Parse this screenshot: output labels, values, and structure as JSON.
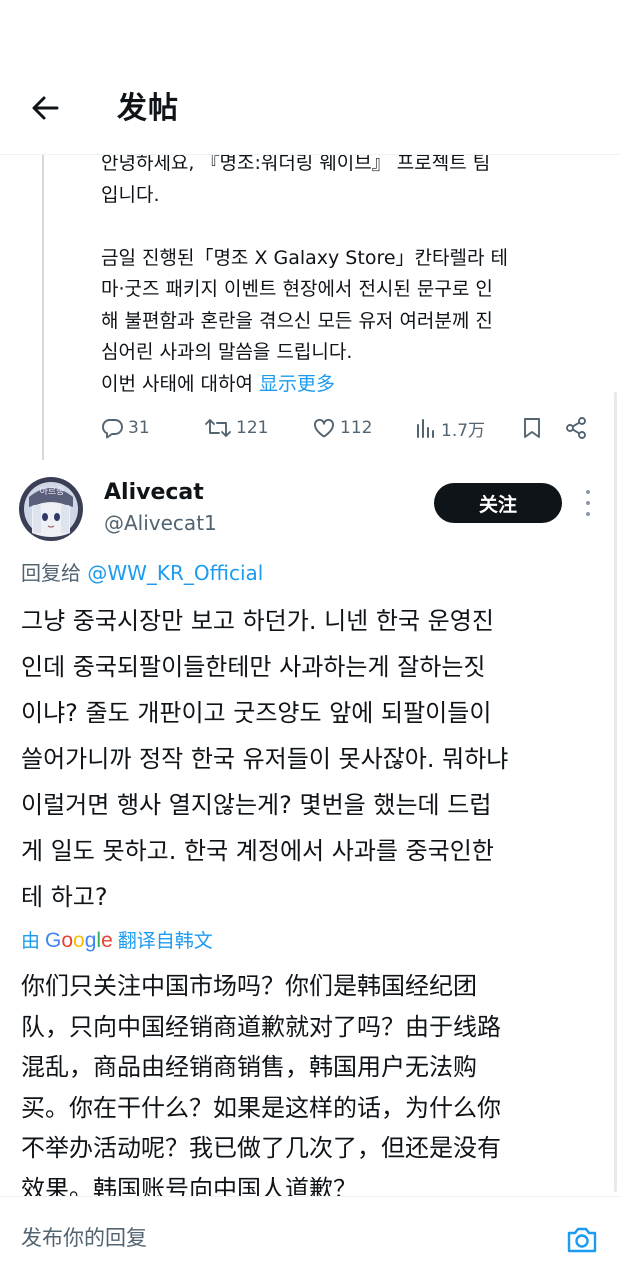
{
  "header": {
    "title": "发帖",
    "back_icon": "arrow-left-icon"
  },
  "previous_tweet": {
    "lines": [
      "안녕하세요, 『명조:워더링 웨이브』 프로젝트 팀",
      "입니다.",
      "",
      "금일 진행된「명조 X Galaxy Store」칸타렐라 테",
      "마·굿즈 패키지 이벤트 현장에서 전시된 문구로 인",
      "해 불편함과 혼란을 겪으신 모든 유저 여러분께 진",
      "심어린 사과의 말씀을 드립니다."
    ],
    "last_line_prefix": "이번 사태에 대하여 ",
    "show_more": "显示更多",
    "actions": {
      "replies": "31",
      "reposts": "121",
      "likes": "112",
      "views": "1.7万"
    }
  },
  "reply_tweet": {
    "display_name": "Alivecat",
    "handle": "@Alivecat1",
    "follow_label": "关注",
    "reply_to_prefix": "回复给 ",
    "reply_to_mention": "@WW_KR_Official",
    "text_lines": [
      "그냥 중국시장만 보고 하던가. 니넨 한국 운영진",
      "인데 중국되팔이들한테만 사과하는게 잘하는짓",
      "이냐? 줄도 개판이고 굿즈양도 앞에 되팔이들이",
      "쓸어가니까 정작 한국 유저들이 못사잖아. 뭐하냐",
      "이럴거면 행사 열지않는게? 몇번을 했는데 드럽",
      "게 일도 못하고. 한국 계정에서 사과를 중국인한",
      "테 하고?"
    ],
    "translated_prefix": "由",
    "translated_brand": "Google",
    "translated_suffix": "翻译自韩文",
    "translation_lines": [
      "你们只关注中国市场吗？你们是韩国经纪团",
      "队，只向中国经销商道歉就对了吗？由于线路",
      "混乱，商品由经销商销售，韩国用户无法购",
      "买。你在干什么？如果是这样的话，为什么你",
      "不举办活动呢？我已做了几次了，但还是没有",
      "效果。韩国账号向中国人道歉？"
    ]
  },
  "composer": {
    "placeholder": "发布你的回复",
    "camera_icon": "camera-icon"
  },
  "colors": {
    "accent": "#1d9bf0",
    "text": "#0f1419",
    "muted": "#536471",
    "follow_bg": "#0f1419"
  }
}
